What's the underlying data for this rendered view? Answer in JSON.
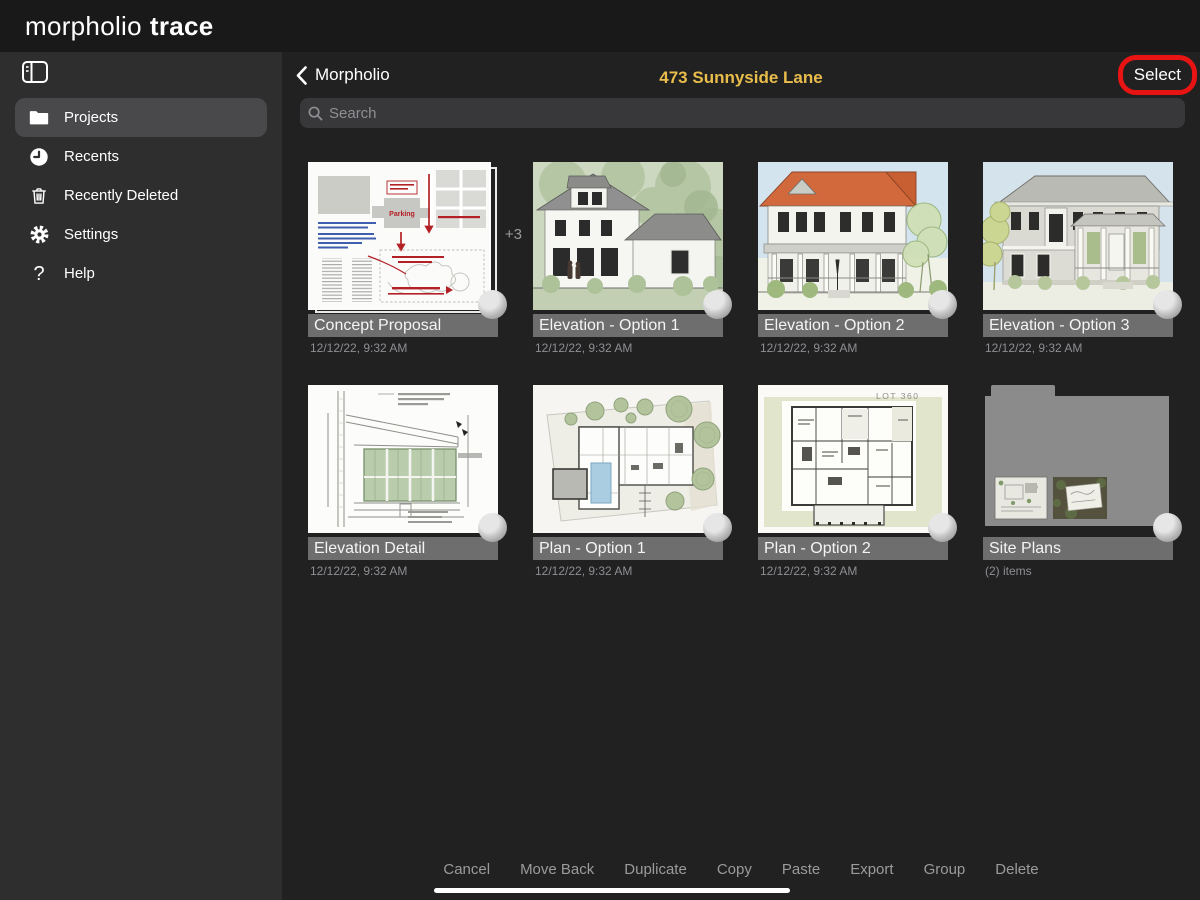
{
  "topbar": {
    "logo_primary": "morpholio",
    "logo_secondary": "trace"
  },
  "sidebar": {
    "items": [
      {
        "label": "Projects",
        "icon": "folder-icon",
        "selected": true
      },
      {
        "label": "Recents",
        "icon": "clock-icon",
        "selected": false
      },
      {
        "label": "Recently Deleted",
        "icon": "trash-icon",
        "selected": false
      },
      {
        "label": "Settings",
        "icon": "gear-icon",
        "selected": false
      },
      {
        "label": "Help",
        "icon": "question-icon",
        "selected": false
      }
    ]
  },
  "header": {
    "back_label": "Morpholio",
    "title": "473 Sunnyside Lane",
    "select_label": "Select"
  },
  "search": {
    "placeholder": "Search"
  },
  "grid": {
    "cards": [
      {
        "title": "Concept Proposal",
        "meta": "12/12/22, 9:32 AM",
        "stack_badge": "+3"
      },
      {
        "title": "Elevation - Option 1",
        "meta": "12/12/22, 9:32 AM"
      },
      {
        "title": "Elevation - Option 2",
        "meta": "12/12/22, 9:32 AM"
      },
      {
        "title": "Elevation - Option 3",
        "meta": "12/12/22, 9:32 AM"
      },
      {
        "title": "Elevation Detail",
        "meta": "12/12/22, 9:32 AM"
      },
      {
        "title": "Plan - Option 1",
        "meta": "12/12/22, 9:32 AM"
      },
      {
        "title": "Plan - Option 2",
        "meta": "12/12/22, 9:32 AM"
      },
      {
        "title": "Site Plans",
        "meta": "(2) items",
        "type": "folder"
      }
    ]
  },
  "thumb_text": {
    "parking": "Parking",
    "lot": "LOT 360"
  },
  "toolbar": {
    "actions": [
      "Cancel",
      "Move Back",
      "Duplicate",
      "Copy",
      "Paste",
      "Export",
      "Group",
      "Delete"
    ]
  },
  "colors": {
    "accent_title": "#e9bd4b",
    "annotation_red": "#e81313"
  }
}
